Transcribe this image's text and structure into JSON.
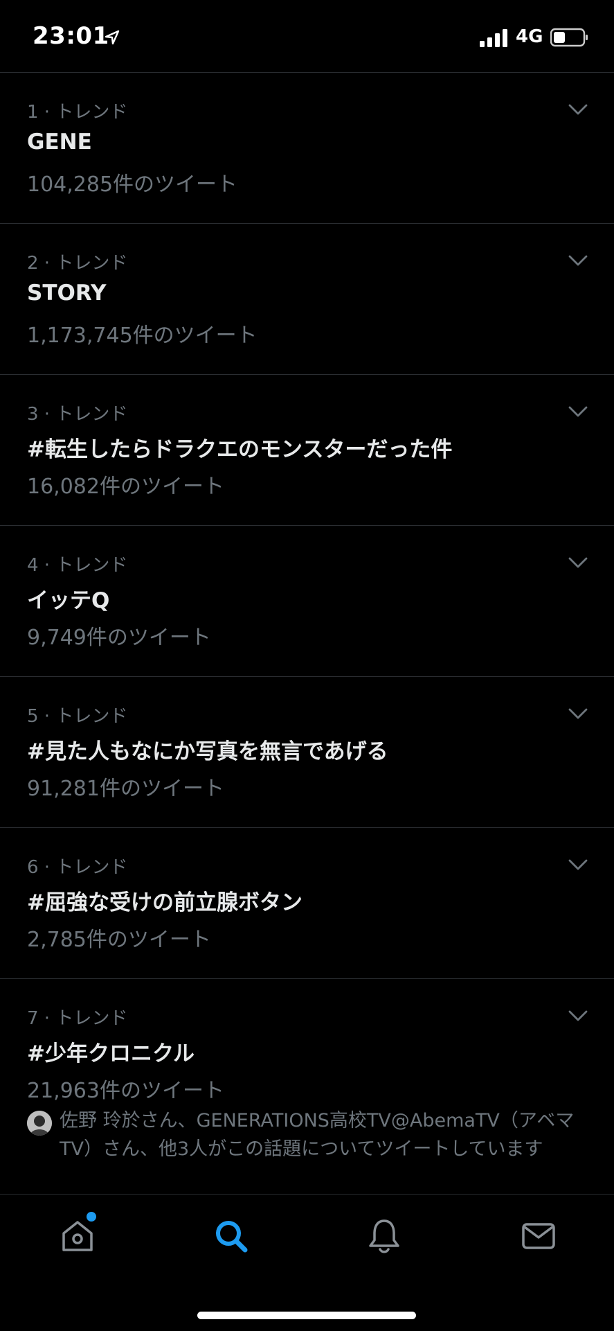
{
  "status_bar": {
    "time": "23:01",
    "network": "4G",
    "icons": [
      "location-arrow-icon",
      "signal-bars-icon",
      "battery-icon"
    ]
  },
  "trends": [
    {
      "meta": "1 · トレンド",
      "name": "GENE",
      "count": "104,285件のツイート"
    },
    {
      "meta": "2 · トレンド",
      "name": "STORY",
      "count": "1,173,745件のツイート"
    },
    {
      "meta": "3 · トレンド",
      "name": "#転生したらドラクエのモンスターだった件",
      "count": "16,082件のツイート"
    },
    {
      "meta": "4 · トレンド",
      "name": "イッテQ",
      "count": "9,749件のツイート"
    },
    {
      "meta": "5 · トレンド",
      "name": "#見た人もなにか写真を無言であげる",
      "count": "91,281件のツイート"
    },
    {
      "meta": "6 · トレンド",
      "name": "#屈強な受けの前立腺ボタン",
      "count": "2,785件のツイート"
    },
    {
      "meta": "7 · トレンド",
      "name": "#少年クロニクル",
      "count": "21,963件のツイート",
      "context": "佐野 玲於さん、GENERATIONS高校TV@AbemaTV（アベマTV）さん、他3人がこの話題についてツイートしています"
    }
  ],
  "tab_bar": {
    "tabs": [
      "home-icon",
      "search-icon",
      "notifications-icon",
      "messages-icon"
    ],
    "active": "search-icon",
    "accent_color": "#1d9bf0"
  }
}
